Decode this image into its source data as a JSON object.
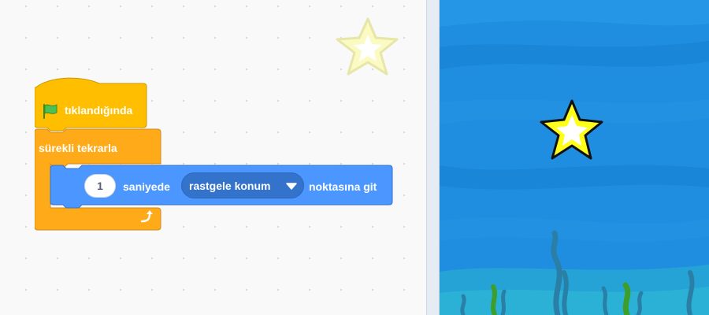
{
  "code_area": {
    "hat_block": {
      "label": "tıklandığında",
      "icon": "green-flag-icon"
    },
    "forever_block": {
      "label": "sürekli tekrarla",
      "icon": "loop-arrow-icon"
    },
    "glide_block": {
      "seconds_value": "1",
      "label_secs": "saniyede",
      "target_dropdown": "rastgele konum",
      "label_tail": "noktasına git"
    }
  },
  "colors": {
    "events": "#ffbf00",
    "control": "#ffab19",
    "motion": "#4c97ff",
    "stage_water": "#1f8de0",
    "star": "#ffff1a"
  }
}
